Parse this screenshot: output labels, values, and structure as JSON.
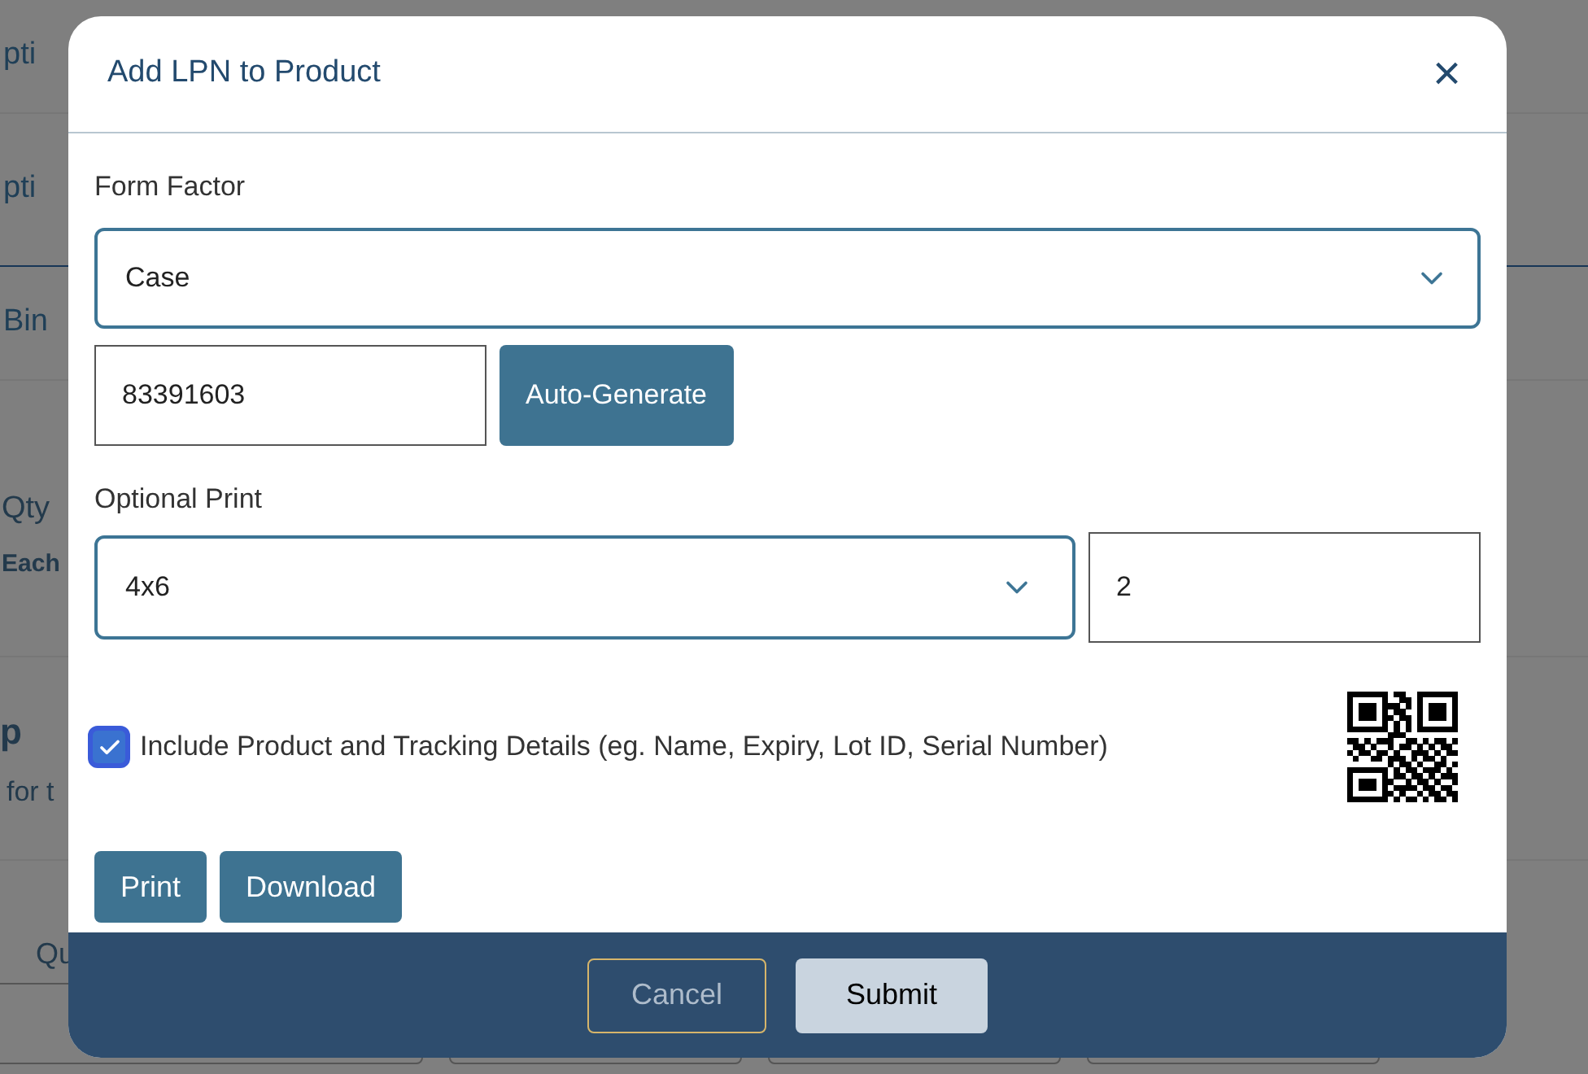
{
  "background": {
    "rows": [
      {
        "text": "pti"
      },
      {
        "text": "pti"
      },
      {
        "text": "Bin"
      }
    ],
    "qty_label": "Qty",
    "qty_unit": "Each",
    "section_title": "p",
    "section_text": "for t",
    "field_label": "Qu"
  },
  "dialog": {
    "title": "Add LPN to Product",
    "close": "×",
    "form_factor": {
      "label": "Form Factor",
      "value": "Case"
    },
    "lpn": {
      "value": "83391603",
      "button": "Auto-Generate"
    },
    "optional_print": {
      "label": "Optional Print",
      "value": "4x6",
      "copies": "2"
    },
    "include_details": {
      "label": "Include Product and Tracking Details (eg. Name, Expiry, Lot ID, Serial Number)",
      "checked": true
    },
    "actions": [
      "Print",
      "Download"
    ],
    "footer": [
      {
        "label": "Cancel",
        "kind": "secondary"
      },
      {
        "label": "Submit",
        "kind": "primary"
      }
    ]
  }
}
